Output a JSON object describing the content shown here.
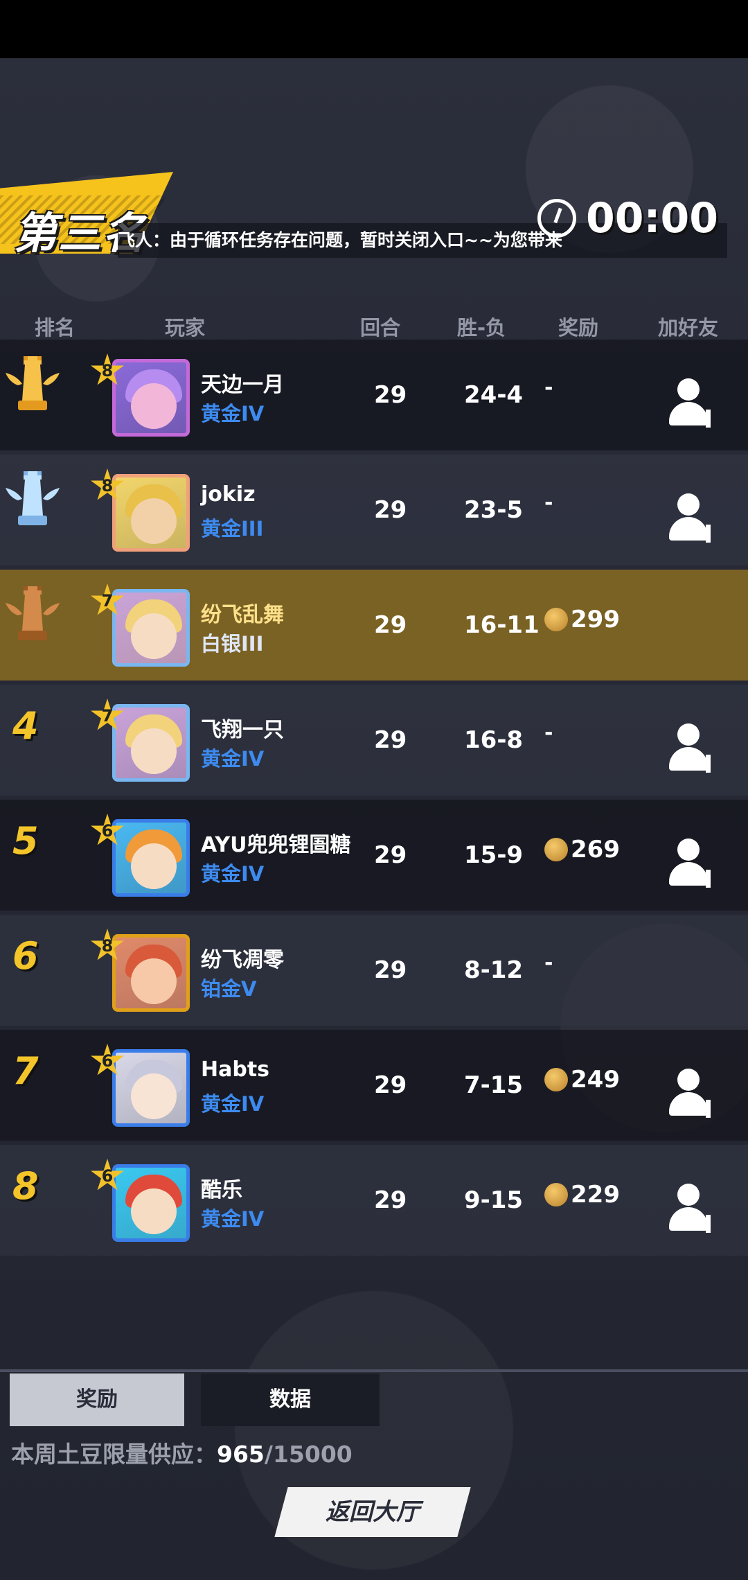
{
  "header": {
    "place_title": "第三名",
    "marquee": "飞人：由于循环任务存在问题，暂时关闭入口~~为您带来",
    "timer": "00:00"
  },
  "columns": {
    "rank": "排名",
    "player": "玩家",
    "rounds": "回合",
    "win_loss": "胜-负",
    "reward": "奖励",
    "add_friend": "加好友"
  },
  "rows": [
    {
      "rank": "1",
      "rank_badge": "gold-trophy-icon",
      "level": "8",
      "name": "天边一月",
      "tier": "黄金IV",
      "rounds": "29",
      "wl": "24-4",
      "reward": "-",
      "has_reward": false,
      "add_friend": true
    },
    {
      "rank": "2",
      "rank_badge": "silver-trophy-icon",
      "level": "8",
      "name": "jokiz",
      "tier": "黄金III",
      "rounds": "29",
      "wl": "23-5",
      "reward": "-",
      "has_reward": false,
      "add_friend": true
    },
    {
      "rank": "3",
      "rank_badge": "bronze-trophy-icon",
      "level": "7",
      "name": "纷飞乱舞",
      "tier": "白银III",
      "rounds": "29",
      "wl": "16-11",
      "reward": "299",
      "has_reward": true,
      "add_friend": false,
      "is_self": true
    },
    {
      "rank": "4",
      "level": "7",
      "name": "飞翔一只",
      "tier": "黄金IV",
      "rounds": "29",
      "wl": "16-8",
      "reward": "-",
      "has_reward": false,
      "add_friend": true
    },
    {
      "rank": "5",
      "level": "6",
      "name": "AYU兜兜锂圄糖",
      "tier": "黄金IV",
      "rounds": "29",
      "wl": "15-9",
      "reward": "269",
      "has_reward": true,
      "add_friend": true
    },
    {
      "rank": "6",
      "level": "8",
      "name": "纷飞凋零",
      "tier": "铂金V",
      "rounds": "29",
      "wl": "8-12",
      "reward": "-",
      "has_reward": false,
      "add_friend": false
    },
    {
      "rank": "7",
      "level": "6",
      "name": "Habts",
      "tier": "黄金IV",
      "rounds": "29",
      "wl": "7-15",
      "reward": "249",
      "has_reward": true,
      "add_friend": true
    },
    {
      "rank": "8",
      "level": "6",
      "name": "酷乐",
      "tier": "黄金IV",
      "rounds": "29",
      "wl": "9-15",
      "reward": "229",
      "has_reward": true,
      "add_friend": true
    }
  ],
  "tabs": {
    "reward": "奖励",
    "data": "数据"
  },
  "supply": {
    "label": "本周土豆限量供应：",
    "current": "965",
    "total": "/15000"
  },
  "back_button": "返回大厅",
  "colors": {
    "accent_gold": "#f4c52a",
    "tier_blue": "#3d8bf0",
    "self_row": "#7a6224"
  }
}
